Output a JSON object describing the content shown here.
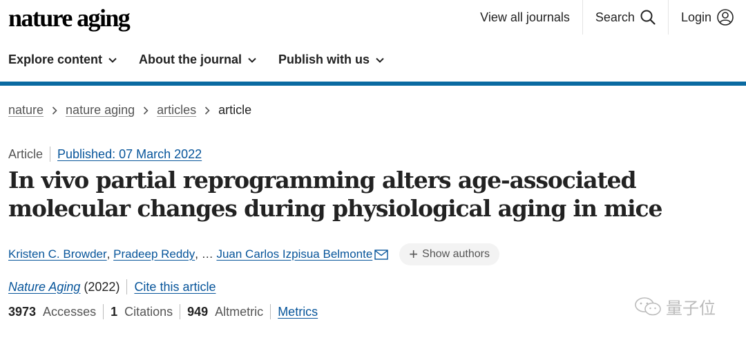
{
  "header": {
    "logo": "nature aging",
    "view_all_journals": "View all journals",
    "search": "Search",
    "login": "Login"
  },
  "nav": {
    "explore": "Explore content",
    "about": "About the journal",
    "publish": "Publish with us"
  },
  "breadcrumb": {
    "items": [
      "nature",
      "nature aging",
      "articles"
    ],
    "current": "article"
  },
  "article": {
    "type": "Article",
    "published": "Published: 07 March 2022",
    "title": "In vivo partial reprogramming alters age-associated molecular changes during physiological aging in mice",
    "authors": {
      "first": "Kristen C. Browder",
      "second": "Pradeep Reddy",
      "ellipsis": "…",
      "last": "Juan Carlos Izpisua Belmonte"
    },
    "show_authors": "Show authors",
    "journal": "Nature Aging",
    "year": "(2022)",
    "cite": "Cite this article"
  },
  "metrics": {
    "accesses_count": "3973",
    "accesses_label": "Accesses",
    "citations_count": "1",
    "citations_label": "Citations",
    "altmetric_count": "949",
    "altmetric_label": "Altmetric",
    "metrics_link": "Metrics"
  },
  "watermark": "量子位",
  "icons": [
    "search-icon",
    "user-icon",
    "chevron-down-icon",
    "chevron-right-icon",
    "mail-icon",
    "plus-icon",
    "wechat-icon"
  ],
  "colors": {
    "accent_bar": "#0a6aa1",
    "link": "#06549a"
  }
}
